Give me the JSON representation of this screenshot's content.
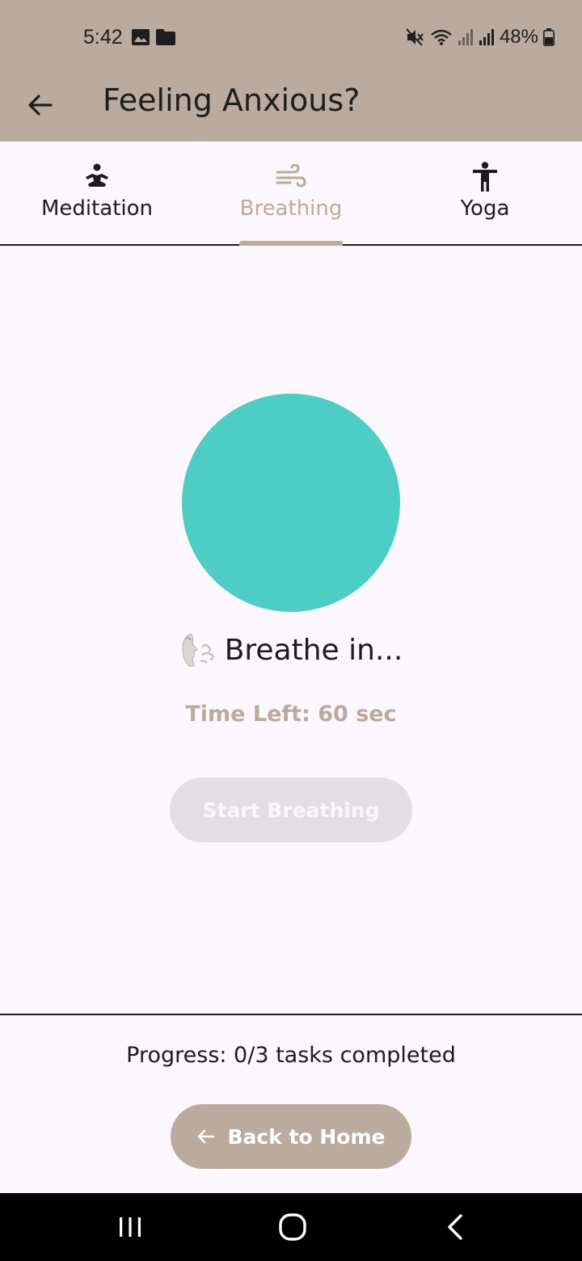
{
  "status_bar": {
    "time": "5:42",
    "battery": "48%",
    "icons": [
      "image-icon",
      "folder-icon",
      "mute-icon",
      "wifi-icon",
      "signal-icon",
      "signal-icon",
      "battery-icon"
    ]
  },
  "app_bar": {
    "title": "Feeling Anxious?",
    "back_icon": "arrow-left-icon"
  },
  "tabs": [
    {
      "label": "Meditation",
      "icon": "meditation-icon",
      "active": false
    },
    {
      "label": "Breathing",
      "icon": "air-icon",
      "active": true
    },
    {
      "label": "Yoga",
      "icon": "accessibility-icon",
      "active": false
    }
  ],
  "breathing": {
    "circle_color": "#4ECDC4",
    "emoji": "face-exhaling-icon",
    "instruction": "Breathe in...",
    "time_left": "Time Left: 60 sec",
    "start_label": "Start Breathing"
  },
  "footer": {
    "progress": "Progress: 0/3 tasks completed",
    "home_label": "Back to Home"
  },
  "colors": {
    "accent": "#BBAA9E",
    "background": "#FCF7FC",
    "circle": "#4ECDC4"
  }
}
